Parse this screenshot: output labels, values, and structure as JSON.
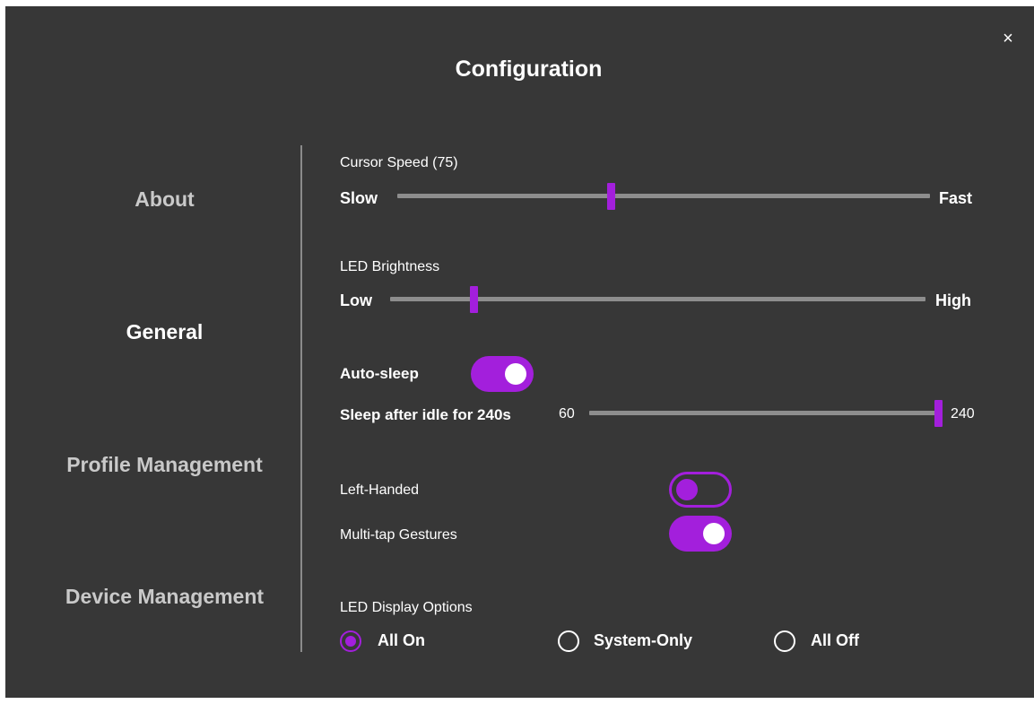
{
  "window": {
    "title": "Configuration",
    "close_glyph": "×"
  },
  "nav": {
    "items": [
      {
        "label": "About",
        "active": false
      },
      {
        "label": "General",
        "active": true
      },
      {
        "label": "Profile Management",
        "active": false
      },
      {
        "label": "Device Management",
        "active": false
      }
    ]
  },
  "cursor_speed": {
    "label": "Cursor Speed (75)",
    "min_label": "Slow",
    "max_label": "Fast",
    "value": 75,
    "level": 0.4
  },
  "led_brightness": {
    "label": "LED Brightness",
    "min_label": "Low",
    "max_label": "High",
    "level": 0.16
  },
  "auto_sleep": {
    "label": "Auto-sleep",
    "enabled": true
  },
  "sleep_idle": {
    "label": "Sleep after idle for 240s",
    "min_label": "60",
    "max_label": "240",
    "value": 240,
    "min": 60,
    "max": 240
  },
  "left_handed": {
    "label": "Left-Handed",
    "enabled": false
  },
  "multitap": {
    "label": "Multi-tap Gestures",
    "enabled": true
  },
  "led_display": {
    "label": "LED Display Options",
    "options": [
      {
        "label": "All On",
        "selected": true
      },
      {
        "label": "System-Only",
        "selected": false
      },
      {
        "label": "All Off",
        "selected": false
      }
    ]
  },
  "colors": {
    "accent": "#a31fdc",
    "background": "#373737",
    "track": "#8d8d8d"
  }
}
